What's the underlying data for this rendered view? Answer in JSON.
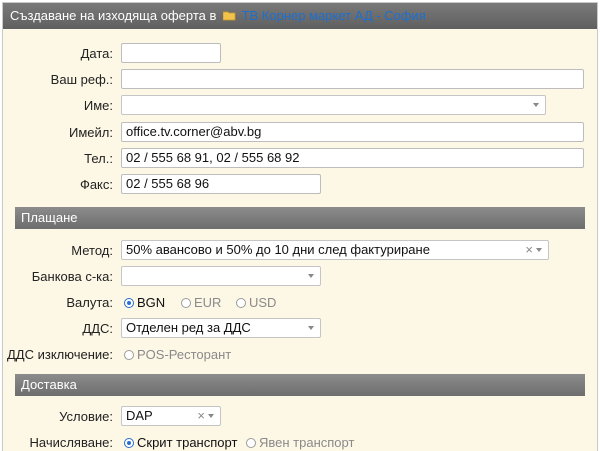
{
  "header": {
    "title": "Създаване на изходяща оферта в",
    "folder_icon": "folder-icon",
    "company_link": "ТВ Корнер маркет АД - София"
  },
  "form": {
    "date": {
      "label": "Дата:",
      "value": ""
    },
    "your_ref": {
      "label": "Ваш реф.:",
      "value": ""
    },
    "name": {
      "label": "Име:",
      "value": ""
    },
    "email": {
      "label": "Имейл:",
      "value": "office.tv.corner@abv.bg"
    },
    "phone": {
      "label": "Тел.:",
      "value": "02 / 555 68 91, 02 / 555 68 92"
    },
    "fax": {
      "label": "Факс:",
      "value": "02 / 555 68 96"
    }
  },
  "payment": {
    "section_title": "Плащане",
    "method": {
      "label": "Метод:",
      "value": "50% авансово и 50% до 10 дни след фактуриране"
    },
    "bank_account": {
      "label": "Банкова с-ка:",
      "value": ""
    },
    "currency": {
      "label": "Валута:",
      "options": [
        "BGN",
        "EUR",
        "USD"
      ],
      "selected": "BGN"
    },
    "vat": {
      "label": "ДДС:",
      "value": "Отделен ред за ДДС"
    },
    "vat_exclusion": {
      "label": "ДДС изключение:",
      "option": "POS-Ресторант"
    }
  },
  "delivery": {
    "section_title": "Доставка",
    "condition": {
      "label": "Условие:",
      "value": "DAP"
    },
    "charging": {
      "label": "Начисляване:",
      "options": [
        "Скрит транспорт",
        "Явен транспорт"
      ],
      "selected": "Скрит транспорт"
    }
  },
  "colors": {
    "panel_bg": "#fdf7e6",
    "header_bg": "#6b6b6b",
    "link": "#1c6fd1",
    "radio_active": "#2a6ed0"
  }
}
